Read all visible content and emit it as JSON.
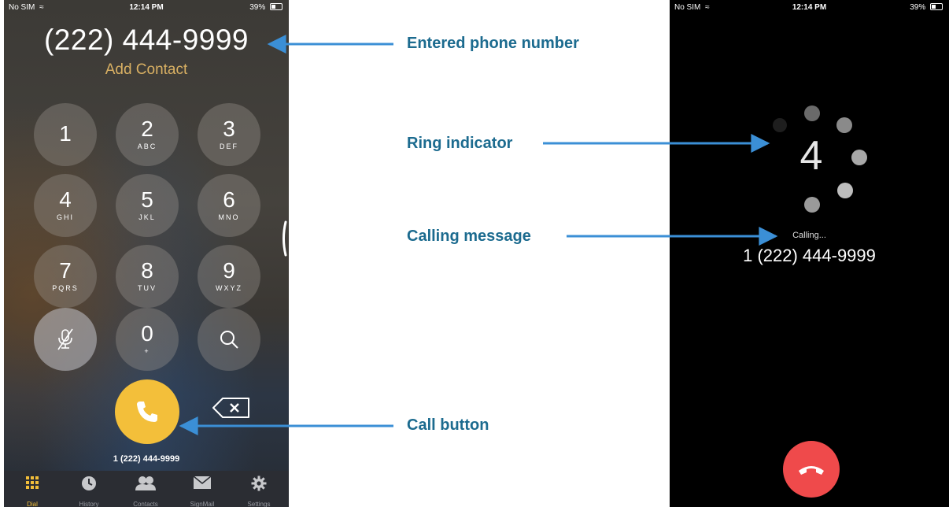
{
  "dialer": {
    "status": {
      "carrier": "No SIM",
      "time": "12:14 PM",
      "battery": "39%"
    },
    "entered_number": "(222) 444-9999",
    "add_contact": "Add Contact",
    "keys": [
      {
        "digit": "1",
        "letters": ""
      },
      {
        "digit": "2",
        "letters": "ABC"
      },
      {
        "digit": "3",
        "letters": "DEF"
      },
      {
        "digit": "4",
        "letters": "GHI"
      },
      {
        "digit": "5",
        "letters": "JKL"
      },
      {
        "digit": "6",
        "letters": "MNO"
      },
      {
        "digit": "7",
        "letters": "PQRS"
      },
      {
        "digit": "8",
        "letters": "TUV"
      },
      {
        "digit": "9",
        "letters": "WXYZ"
      },
      {
        "digit": "0",
        "letters": "+"
      }
    ],
    "dialed_number_echo": "1 (222) 444-9999",
    "tabs": [
      {
        "label": "Dial",
        "icon": "dial-pad-icon",
        "active": true
      },
      {
        "label": "History",
        "icon": "clock-icon",
        "active": false
      },
      {
        "label": "Contacts",
        "icon": "contacts-icon",
        "active": false
      },
      {
        "label": "SignMail",
        "icon": "envelope-icon",
        "active": false
      },
      {
        "label": "Settings",
        "icon": "gear-icon",
        "active": false
      }
    ],
    "accent_color": "#f3bf3a"
  },
  "calling": {
    "status": {
      "carrier": "No SIM",
      "time": "12:14 PM",
      "battery": "39%"
    },
    "ring_count": "4",
    "message": "Calling...",
    "number": "1 (222) 444-9999",
    "hangup_color": "#ef4a4b"
  },
  "callouts": {
    "entered_number": "Entered phone number",
    "ring_indicator": "Ring indicator",
    "calling_message": "Calling message",
    "call_button": "Call button",
    "color": "#1c6b8f",
    "arrow_color": "#3b8fd6"
  }
}
